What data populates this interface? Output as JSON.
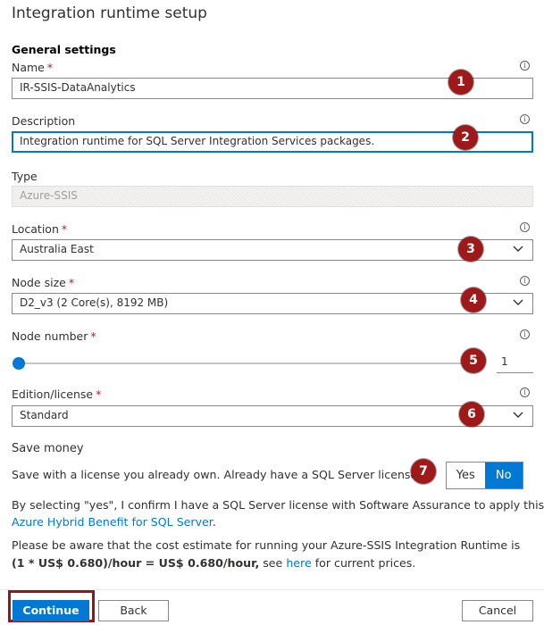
{
  "header": {
    "title": "Integration runtime setup"
  },
  "general": {
    "section_title": "General settings"
  },
  "name": {
    "label": "Name",
    "required": "*",
    "value": "IR-SSIS-DataAnalytics"
  },
  "description": {
    "label": "Description",
    "value": "Integration runtime for SQL Server Integration Services packages."
  },
  "type": {
    "label": "Type",
    "value": "Azure-SSIS"
  },
  "location": {
    "label": "Location",
    "required": "*",
    "value": "Australia East"
  },
  "node_size": {
    "label": "Node size",
    "required": "*",
    "value": "D2_v3 (2 Core(s), 8192 MB)"
  },
  "node_number": {
    "label": "Node number",
    "required": "*",
    "value": "1",
    "slider_fraction": 0.0
  },
  "edition": {
    "label": "Edition/license",
    "required": "*",
    "value": "Standard"
  },
  "save_money": {
    "heading": "Save money",
    "question": "Save with a license you already own. Already have a SQL Server license?",
    "yes_label": "Yes",
    "no_label": "No",
    "selected": "No"
  },
  "confirm": {
    "line1": "By selecting \"yes\", I confirm I have a SQL Server license with Software Assurance to apply this",
    "link": "Azure Hybrid Benefit for SQL Server",
    "link_suffix": "."
  },
  "cost": {
    "line1": "Please be aware that the cost estimate for running your Azure-SSIS Integration Runtime is",
    "formula": "(1 * US$ 0.680)/hour = US$ 0.680/hour,",
    "middle": " see ",
    "link": "here",
    "suffix": " for current prices."
  },
  "callouts": [
    "1",
    "2",
    "3",
    "4",
    "5",
    "6",
    "7"
  ],
  "info_glyph": "i",
  "footer": {
    "continue_label": "Continue",
    "back_label": "Back",
    "cancel_label": "Cancel"
  },
  "colors": {
    "accent": "#0078d4",
    "callout": "#9e1a1a",
    "required": "#a4262c",
    "highlight_border": "#8b1a1a"
  },
  "icons": [
    "info-icon",
    "chevron-down-icon"
  ]
}
